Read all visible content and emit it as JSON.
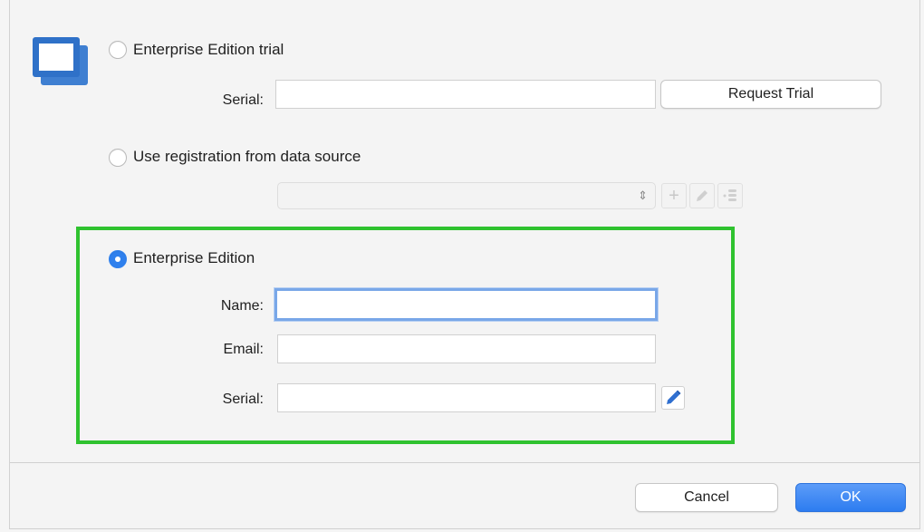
{
  "options": {
    "trial": {
      "label": "Enterprise Edition trial",
      "serial_label": "Serial:",
      "serial_value": "",
      "request_button": "Request Trial"
    },
    "data_source": {
      "label": "Use registration from data source",
      "selected_value": ""
    },
    "enterprise": {
      "label": "Enterprise Edition",
      "name_label": "Name:",
      "name_value": "",
      "email_label": "Email:",
      "email_value": "",
      "serial_label": "Serial:",
      "serial_value": ""
    }
  },
  "selected_option": "enterprise",
  "footer": {
    "cancel": "Cancel",
    "ok": "OK"
  },
  "colors": {
    "accent": "#2f80ed",
    "highlight": "#2fc22f"
  }
}
